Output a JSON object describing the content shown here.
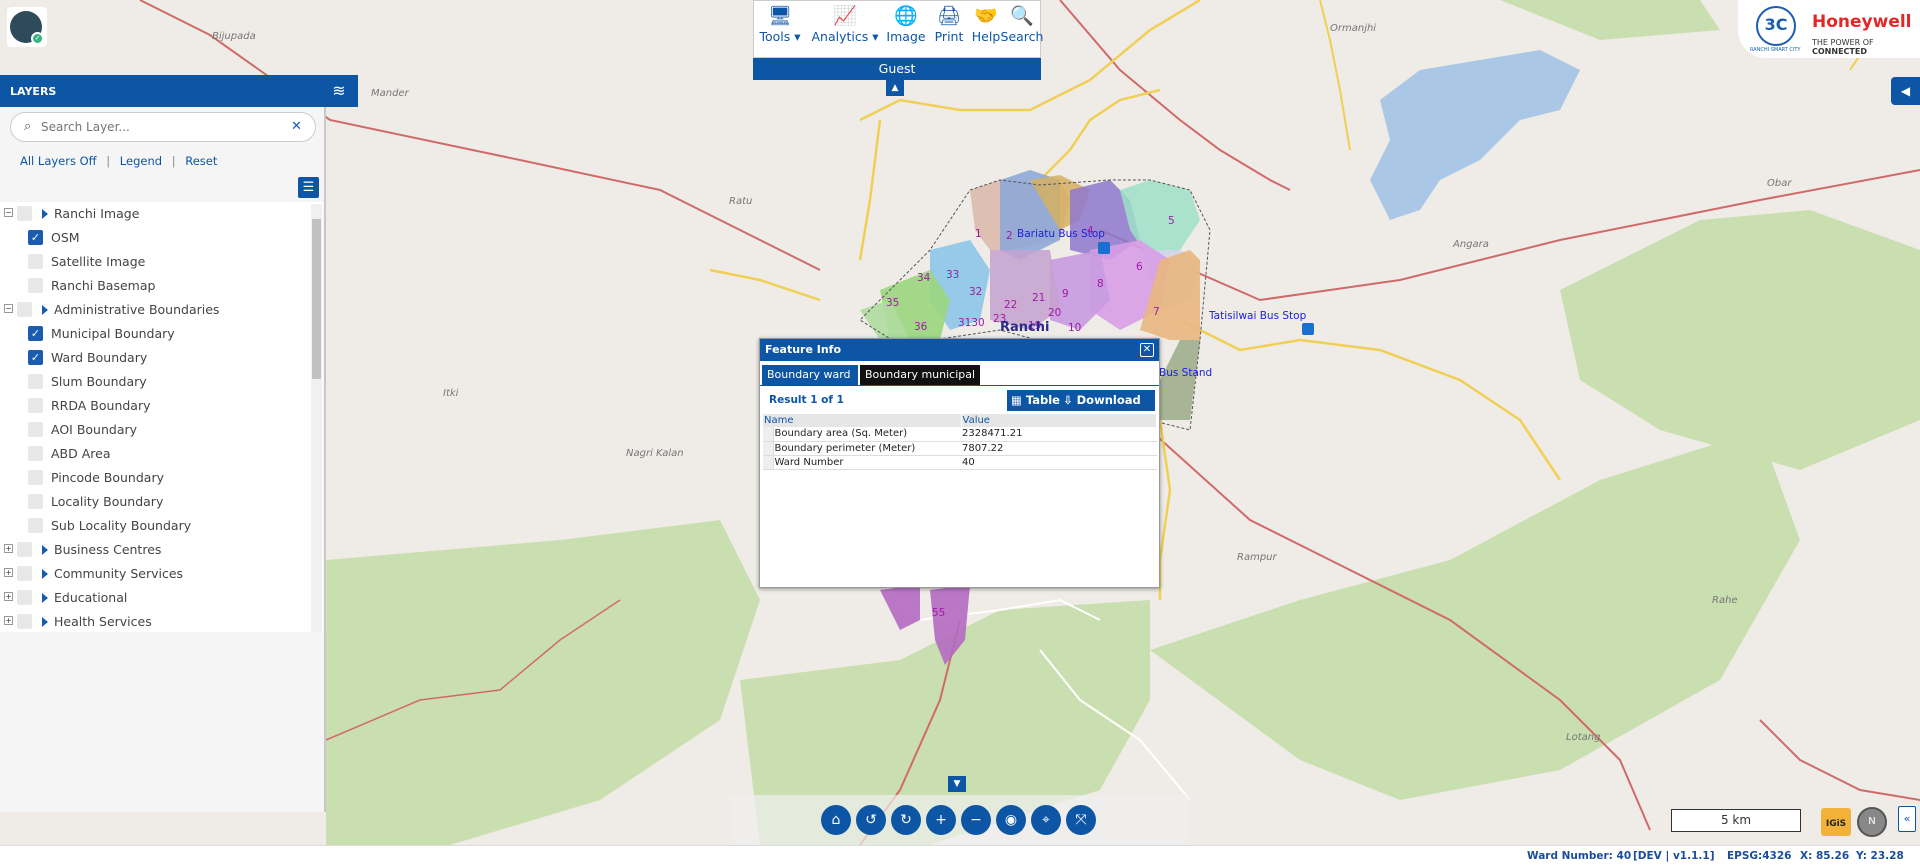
{
  "user": {
    "role": "Guest"
  },
  "layers_panel": {
    "title": "LAYERS",
    "search_placeholder": "Search Layer...",
    "links": [
      "All Layers Off",
      "Legend",
      "Reset"
    ],
    "tree": [
      {
        "label": "Ranchi Image",
        "group": true,
        "checked": false
      },
      {
        "label": "OSM",
        "group": false,
        "checked": true
      },
      {
        "label": "Satellite Image",
        "group": false,
        "checked": false
      },
      {
        "label": "Ranchi Basemap",
        "group": false,
        "checked": false
      },
      {
        "label": "Administrative Boundaries",
        "group": true,
        "checked": false
      },
      {
        "label": "Municipal Boundary",
        "group": false,
        "checked": true
      },
      {
        "label": "Ward Boundary",
        "group": false,
        "checked": true
      },
      {
        "label": "Slum Boundary",
        "group": false,
        "checked": false
      },
      {
        "label": "RRDA Boundary",
        "group": false,
        "checked": false
      },
      {
        "label": "AOI Boundary",
        "group": false,
        "checked": false
      },
      {
        "label": "ABD Area",
        "group": false,
        "checked": false
      },
      {
        "label": "Pincode Boundary",
        "group": false,
        "checked": false
      },
      {
        "label": "Locality Boundary",
        "group": false,
        "checked": false
      },
      {
        "label": "Sub Locality Boundary",
        "group": false,
        "checked": false
      },
      {
        "label": "Business Centres",
        "group": true,
        "checked": false
      },
      {
        "label": "Community Services",
        "group": true,
        "checked": false
      },
      {
        "label": "Educational",
        "group": true,
        "checked": false
      },
      {
        "label": "Health Services",
        "group": true,
        "checked": false
      }
    ]
  },
  "toolbar": {
    "items": [
      {
        "label": "Tools",
        "icon": "monitor-icon",
        "dropdown": true
      },
      {
        "label": "Analytics",
        "icon": "chart-icon",
        "dropdown": true
      },
      {
        "label": "Image",
        "icon": "globe-icon",
        "dropdown": false
      },
      {
        "label": "Print",
        "icon": "printer-icon",
        "dropdown": false
      },
      {
        "label": "Help",
        "icon": "handshake-icon",
        "dropdown": false
      },
      {
        "label": "Search",
        "icon": "search-icon",
        "dropdown": false
      }
    ]
  },
  "logo": {
    "smart_city": "RANCHI SMART CITY",
    "brand": "Honeywell",
    "tagline_prefix": "THE POWER OF ",
    "tagline_strong": "CONNECTED"
  },
  "feature_info": {
    "title": "Feature Info",
    "tabs": [
      "Boundary ward",
      "Boundary municipal"
    ],
    "active_tab": "Boundary municipal",
    "result": "Result 1 of 1",
    "table_button": "Table",
    "download_button": "Download",
    "columns": [
      "Name",
      "Value"
    ],
    "rows": [
      {
        "name": "Boundary area (Sq. Meter)",
        "value": "2328471.21"
      },
      {
        "name": "Boundary perimeter (Meter)",
        "value": "7807.22"
      },
      {
        "name": "Ward Number",
        "value": "40"
      }
    ]
  },
  "map": {
    "place_labels": [
      "Bijupada",
      "Mander",
      "Ratu",
      "Itki",
      "Nagri Kalan",
      "Ormanjhi",
      "Obar",
      "Angara",
      "Rampur",
      "Rahe",
      "Lotang"
    ],
    "bus_stops": [
      "Bariatu Bus Stop",
      "Tatisilwai Bus Stop",
      "Bus Stand"
    ],
    "ward_numbers": [
      "1",
      "2",
      "4",
      "5",
      "6",
      "7",
      "8",
      "9",
      "10",
      "19",
      "20",
      "21",
      "22",
      "23",
      "3130",
      "32",
      "33",
      "34",
      "35",
      "36",
      "55"
    ],
    "city_label": "Ranchi"
  },
  "scale": "5 km",
  "compass_label": "N",
  "igis_label": "IGiS",
  "status": {
    "ward": "Ward Number: 40",
    "version": "[DEV | v1.1.1]",
    "epsg": "EPSG:4326",
    "x": "X: 85.26",
    "y": "Y: 23.28"
  }
}
